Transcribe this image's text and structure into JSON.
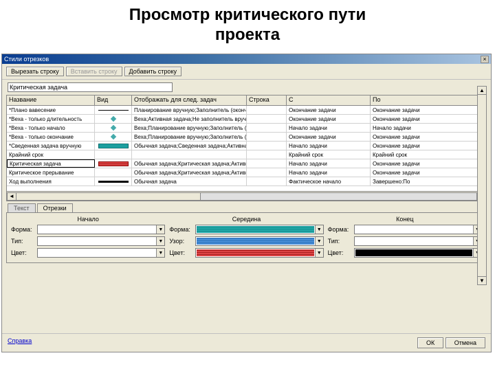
{
  "slide_title_1": "Просмотр критического пути",
  "slide_title_2": "проекта",
  "titlebar": {
    "title": "Стили отрезков",
    "close": "×"
  },
  "toolbar": {
    "cut": "Вырезать строку",
    "paste": "Вставить строку",
    "add": "Добавить строку"
  },
  "name_field": {
    "value": "Критическая задача"
  },
  "columns": {
    "name": "Название",
    "vid": "Вид",
    "otob": "Отображать для след. задач",
    "str": "Строка",
    "s": "С",
    "po": "По"
  },
  "rows": [
    {
      "name": "*Плано вавесение",
      "vid": "line",
      "otob": "Планирование вручную;Заполнитель (окончани",
      "str": "",
      "s": "Окончание задачи",
      "po": "Окончание задачи"
    },
    {
      "name": "*Веха - только длительность",
      "vid": "diamond",
      "otob": "Веха;Активная задача;Не заполнитель вручную;Н",
      "str": "",
      "s": "Окончание задачи",
      "po": "Окончание задачи"
    },
    {
      "name": "*Веха - только начало",
      "vid": "diamond",
      "otob": "Веха;Планирование вручную;Заполнитель (нача",
      "str": "",
      "s": "Начало задачи",
      "po": "Начало задачи"
    },
    {
      "name": "*Веха - только окончание",
      "vid": "diamond",
      "otob": "Веха;Планирование вручную;Заполнитель (окон",
      "str": "",
      "s": "Окончание задачи",
      "po": "Окончание задачи"
    },
    {
      "name": "*Сведенная задача вручную",
      "vid": "teal",
      "otob": "Обычная задача;Сведенная задача;Активная за",
      "str": "",
      "s": "Начало задачи",
      "po": "Окончание задачи"
    },
    {
      "name": "Крайний срок",
      "vid": "",
      "otob": "",
      "str": "",
      "s": "Крайний срок",
      "po": "Крайний срок"
    },
    {
      "name": "Критическая задача",
      "vid": "red",
      "otob": "Обычная задача;Критическая задача;Активная з",
      "str": "",
      "s": "Начало задачи",
      "po": "Окончание задачи",
      "selected": true
    },
    {
      "name": "Критическое прерывание",
      "vid": "",
      "otob": "Обычная задача;Критическая задача;Активная з",
      "str": "",
      "s": "Начало задачи",
      "po": "Окончание задачи"
    },
    {
      "name": "Ход выполнения",
      "vid": "black",
      "otob": "Обычная задача",
      "str": "",
      "s": "Фактическое начало",
      "po": "Завершено:По"
    }
  ],
  "tabs": {
    "text": "Текст",
    "segments": "Отрезки"
  },
  "panel": {
    "start": "Начало",
    "middle": "Середина",
    "end": "Конец",
    "form": "Форма:",
    "uzor": "Узор:",
    "tip": "Тип:",
    "color": "Цвет:"
  },
  "footer": {
    "help": "Справка",
    "ok": "ОК",
    "cancel": "Отмена"
  }
}
